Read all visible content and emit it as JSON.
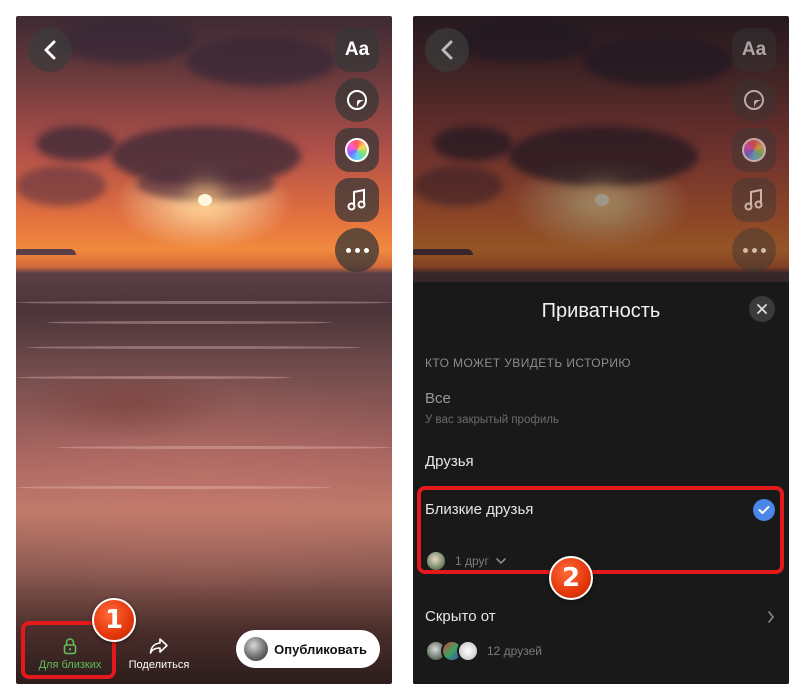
{
  "left_screen": {
    "close_friends_label": "Для близких",
    "share_label": "Поделиться",
    "publish_label": "Опубликовать",
    "badge_number": "1",
    "accent_color": "#5fbf5a"
  },
  "right_screen": {
    "sheet_title": "Приватность",
    "section_header": "КТО МОЖЕТ УВИДЕТЬ ИСТОРИЮ",
    "options": [
      {
        "title": "Все",
        "subtitle": "У вас закрытый профиль"
      },
      {
        "title": "Друзья"
      },
      {
        "title": "Близкие друзья",
        "count": "1 друг",
        "selected": true
      },
      {
        "title": "Скрыто от",
        "count": "12 друзей"
      }
    ],
    "badge_number": "2",
    "check_color": "#4a86e8"
  },
  "toolbar": {
    "text_tool_label": "Aa",
    "icons": [
      "back-icon",
      "text-icon",
      "sticker-icon",
      "color-icon",
      "music-icon",
      "more-icon"
    ]
  },
  "highlight_color": "#e4191b"
}
